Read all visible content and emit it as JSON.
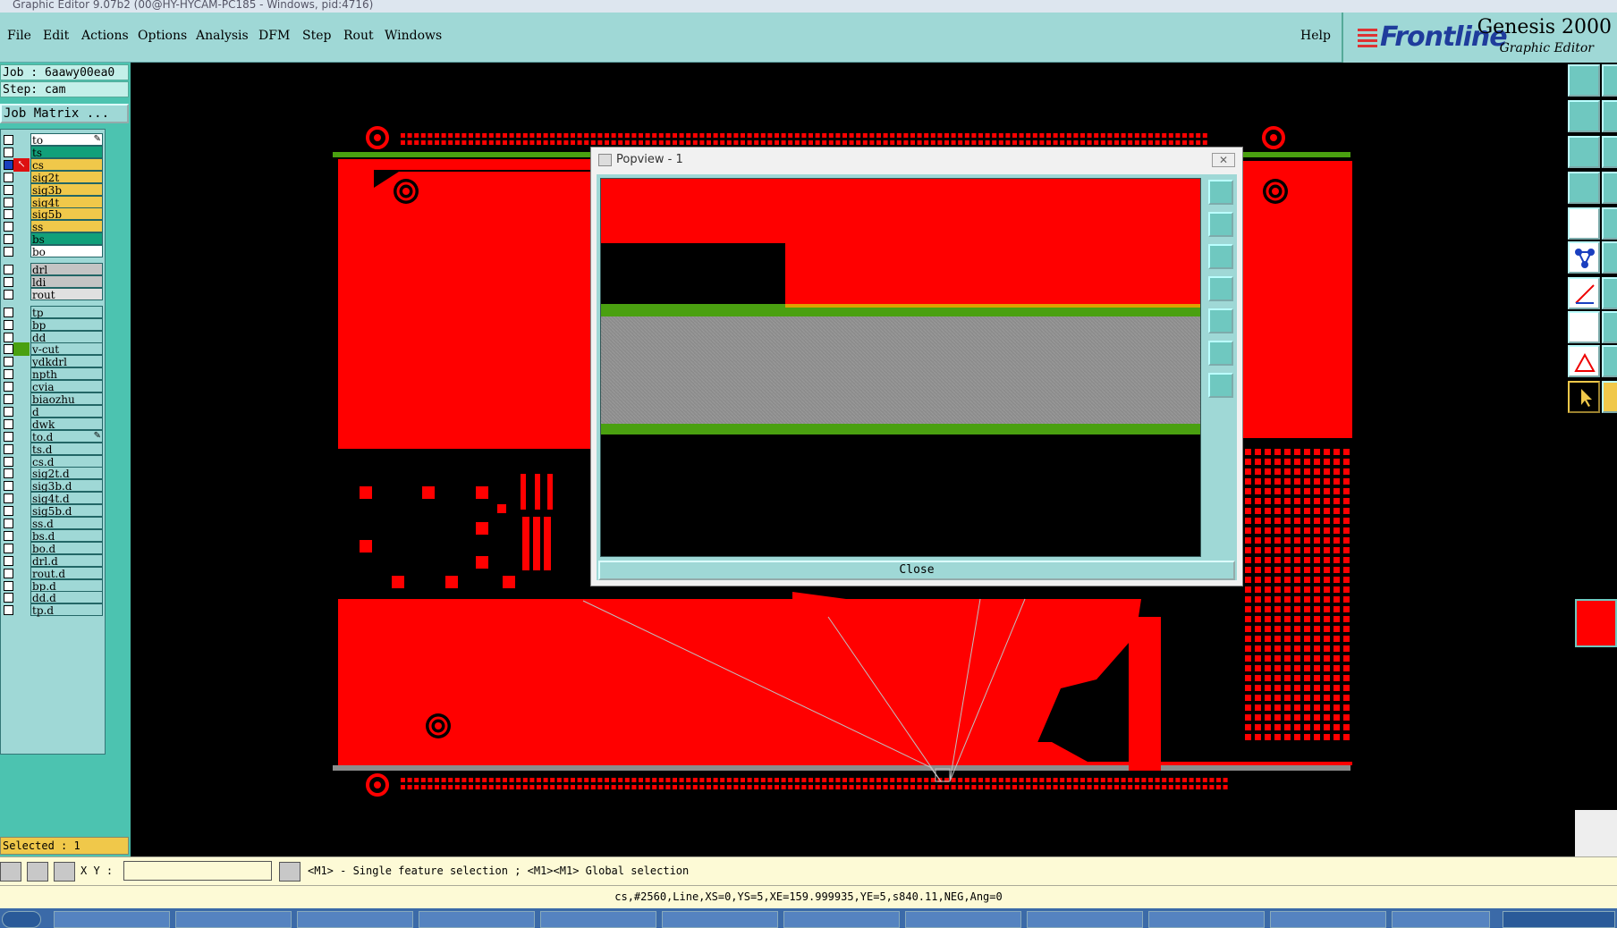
{
  "window": {
    "title": "Graphic Editor 9.07b2 (00@HY-HYCAM-PC185 - Windows, pid:4716)"
  },
  "menu": [
    "File",
    "Edit",
    "Actions",
    "Options",
    "Analysis",
    "DFM",
    "Step",
    "Rout",
    "Windows"
  ],
  "help": "Help",
  "brand": {
    "logo": "Frontline",
    "title": "Genesis 2000",
    "subtitle": "Graphic Editor"
  },
  "job": {
    "job_line": "Job : 6aawy00ea0",
    "step_line": "Step: cam",
    "matrix_button": "Job Matrix ..."
  },
  "layers": [
    {
      "name": "to",
      "color": "#ffffff",
      "mark": "pen"
    },
    {
      "name": "ts",
      "color": "#11a07a"
    },
    {
      "name": "cs",
      "color": "#f0c84a",
      "active": true
    },
    {
      "name": "sig2t",
      "color": "#f0c84a"
    },
    {
      "name": "sig3b",
      "color": "#f0c84a"
    },
    {
      "name": "sig4t",
      "color": "#f0c84a"
    },
    {
      "name": "sig5b",
      "color": "#f0c84a"
    },
    {
      "name": "ss",
      "color": "#f0c84a"
    },
    {
      "name": "bs",
      "color": "#11a07a"
    },
    {
      "name": "bo",
      "color": "#ffffff"
    },
    {
      "name": "drl",
      "color": "#c4c4c4"
    },
    {
      "name": "ldi",
      "color": "#c4c4c4"
    },
    {
      "name": "rout",
      "color": "#e0e0e0"
    },
    {
      "name": "tp",
      "color": "#9fd8d6"
    },
    {
      "name": "bp",
      "color": "#9fd8d6"
    },
    {
      "name": "dd",
      "color": "#9fd8d6"
    },
    {
      "name": "v-cut",
      "color": "#9fd8d6",
      "green": true
    },
    {
      "name": "ydkdrl",
      "color": "#9fd8d6"
    },
    {
      "name": "npth",
      "color": "#9fd8d6"
    },
    {
      "name": "cvia",
      "color": "#9fd8d6"
    },
    {
      "name": "biaozhu",
      "color": "#9fd8d6"
    },
    {
      "name": "d",
      "color": "#9fd8d6"
    },
    {
      "name": "dwk",
      "color": "#9fd8d6"
    },
    {
      "name": "to.d",
      "color": "#9fd8d6",
      "mark": "pen"
    },
    {
      "name": "ts.d",
      "color": "#9fd8d6"
    },
    {
      "name": "cs.d",
      "color": "#9fd8d6"
    },
    {
      "name": "sig2t.d",
      "color": "#9fd8d6"
    },
    {
      "name": "sig3b.d",
      "color": "#9fd8d6"
    },
    {
      "name": "sig4t.d",
      "color": "#9fd8d6"
    },
    {
      "name": "sig5b.d",
      "color": "#9fd8d6"
    },
    {
      "name": "ss.d",
      "color": "#9fd8d6"
    },
    {
      "name": "bs.d",
      "color": "#9fd8d6"
    },
    {
      "name": "bo.d",
      "color": "#9fd8d6"
    },
    {
      "name": "drl.d",
      "color": "#9fd8d6"
    },
    {
      "name": "rout.d",
      "color": "#9fd8d6"
    },
    {
      "name": "bp.d",
      "color": "#9fd8d6"
    },
    {
      "name": "dd.d",
      "color": "#9fd8d6"
    },
    {
      "name": "tp.d",
      "color": "#9fd8d6"
    }
  ],
  "selected": "Selected : 1",
  "popview": {
    "title": "Popview - 1",
    "close_label": "Close"
  },
  "status": {
    "xy_label": "X Y :",
    "xy_value": "",
    "hint": "<M1> - Single feature selection ; <M1><M1> Global selection",
    "feature_info": "cs,#2560,Line,XS=0,YS=5,XE=159.999935,YE=5,s840.11,NEG,Ang=0"
  },
  "colors": {
    "copper": "#ff0000",
    "panel": "#9fd8d6",
    "mask": "#4aa010",
    "core": "#8c8c8c"
  }
}
